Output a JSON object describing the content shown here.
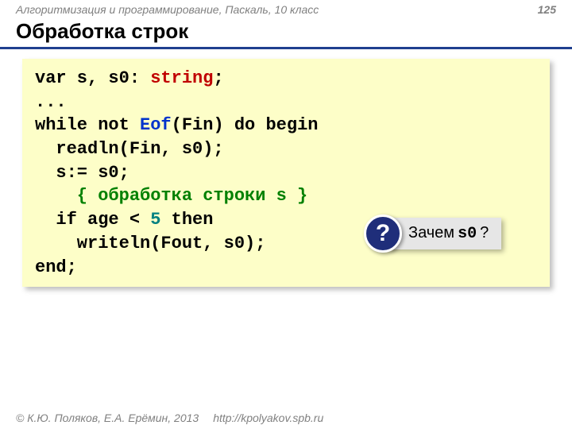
{
  "header": {
    "course": "Алгоритмизация и программирование, Паскаль, 10 класс",
    "page": "125"
  },
  "title": "Обработка строк",
  "code": {
    "l1a": "var s, s0: ",
    "l1b": "string",
    "l1c": ";",
    "l2": "...",
    "l3a": "while not ",
    "l3b": "Eof",
    "l3c": "(Fin) do begin",
    "l4": "  readln(Fin, s0);",
    "l5": "  s:= s0;",
    "l6": "    { обработка строки s }",
    "l7a": "  if age < ",
    "l7b": "5",
    "l7c": " then",
    "l8": "    writeln(Fout, s0);",
    "l9": "end;"
  },
  "callout": {
    "mark": "?",
    "text": "Зачем ",
    "code": "s0",
    "tail": "?"
  },
  "footer": {
    "copyright": "© К.Ю. Поляков, Е.А. Ерёмин, 2013",
    "url": "http://kpolyakov.spb.ru"
  }
}
